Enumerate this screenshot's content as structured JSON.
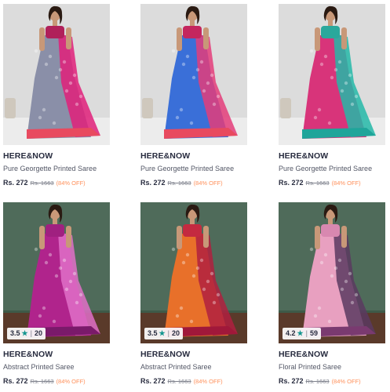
{
  "products": [
    {
      "brand": "HERE&NOW",
      "title": "Pure Georgette Printed Saree",
      "price": "Rs. 272",
      "mrp": "Rs. 1663",
      "discount": "(84% OFF)",
      "rating": null,
      "bg": "#dcdcdc",
      "saree_main": "#8a8fa8",
      "saree_accent": "#e0207a",
      "border": "#e84a5f",
      "blouse": "#b0205a"
    },
    {
      "brand": "HERE&NOW",
      "title": "Pure Georgette Printed Saree",
      "price": "Rs. 272",
      "mrp": "Rs. 1663",
      "discount": "(84% OFF)",
      "rating": null,
      "bg": "#dcdcdc",
      "saree_main": "#3a6fd8",
      "saree_accent": "#e43d7a",
      "border": "#e84a5f",
      "blouse": "#c4265e"
    },
    {
      "brand": "HERE&NOW",
      "title": "Pure Georgette Printed Saree",
      "price": "Rs. 272",
      "mrp": "Rs. 1663",
      "discount": "(84% OFF)",
      "rating": null,
      "bg": "#dcdcdc",
      "saree_main": "#d8347a",
      "saree_accent": "#25b8a8",
      "border": "#1fa59a",
      "blouse": "#2aa89c"
    },
    {
      "brand": "HERE&NOW",
      "title": "Abstract Printed Saree",
      "price": "Rs. 272",
      "mrp": "Rs. 1663",
      "discount": "(84% OFF)",
      "rating": {
        "score": "3.5",
        "count": "20"
      },
      "bg": "#4f6b5a",
      "saree_main": "#b0248c",
      "saree_accent": "#e070c8",
      "border": "#7a1a6a",
      "blouse": "#a02080"
    },
    {
      "brand": "HERE&NOW",
      "title": "Abstract Printed Saree",
      "price": "Rs. 272",
      "mrp": "Rs. 1663",
      "discount": "(84% OFF)",
      "rating": {
        "score": "3.5",
        "count": "20"
      },
      "bg": "#4f6b5a",
      "saree_main": "#e8702a",
      "saree_accent": "#b02040",
      "border": "#a0183a",
      "blouse": "#c42a40"
    },
    {
      "brand": "HERE&NOW",
      "title": "Floral Printed Saree",
      "price": "Rs. 272",
      "mrp": "Rs. 1663",
      "discount": "(84% OFF)",
      "rating": {
        "score": "4.2",
        "count": "59"
      },
      "bg": "#4f6b5a",
      "saree_main": "#e8a0c0",
      "saree_accent": "#5a3a60",
      "border": "#7a3a70",
      "blouse": "#d888b0"
    }
  ]
}
